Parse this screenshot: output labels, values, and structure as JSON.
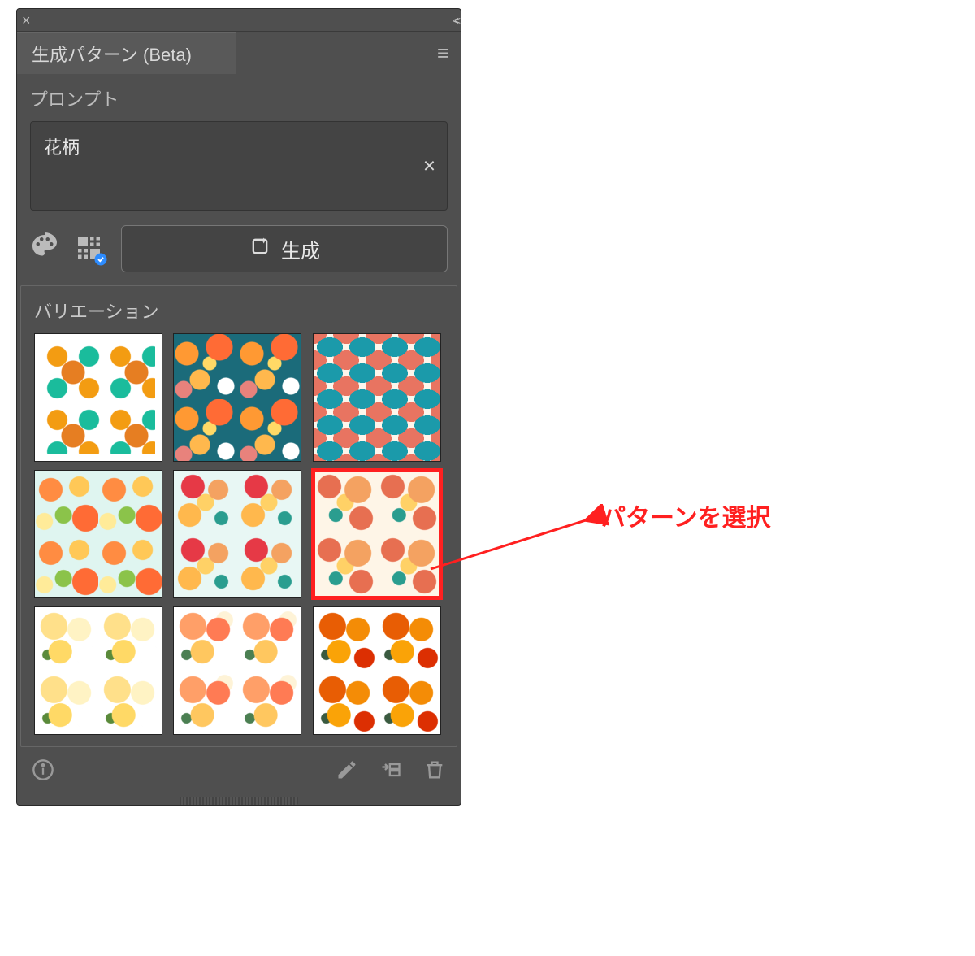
{
  "panel": {
    "title": "生成パターン (Beta)",
    "prompt_label": "プロンプト",
    "prompt_value": "花柄",
    "generate_label": "生成",
    "variations_label": "バリエーション"
  },
  "variations": {
    "selected_index": 5,
    "items": [
      {
        "name": "pattern-1"
      },
      {
        "name": "pattern-2"
      },
      {
        "name": "pattern-3"
      },
      {
        "name": "pattern-4"
      },
      {
        "name": "pattern-5"
      },
      {
        "name": "pattern-6"
      },
      {
        "name": "pattern-7"
      },
      {
        "name": "pattern-8"
      },
      {
        "name": "pattern-9"
      }
    ]
  },
  "annotation": {
    "text": "パターンを選択",
    "color": "#ff2020"
  },
  "icons": {
    "close": "close-icon",
    "collapse": "collapse-icon",
    "menu": "hamburger-icon",
    "palette": "palette-icon",
    "pattern_type": "pattern-type-icon",
    "generate": "sparkle-generate-icon",
    "info": "info-icon",
    "edit": "pencil-icon",
    "apply": "apply-to-layer-icon",
    "trash": "trash-icon",
    "clear": "clear-x-icon"
  }
}
